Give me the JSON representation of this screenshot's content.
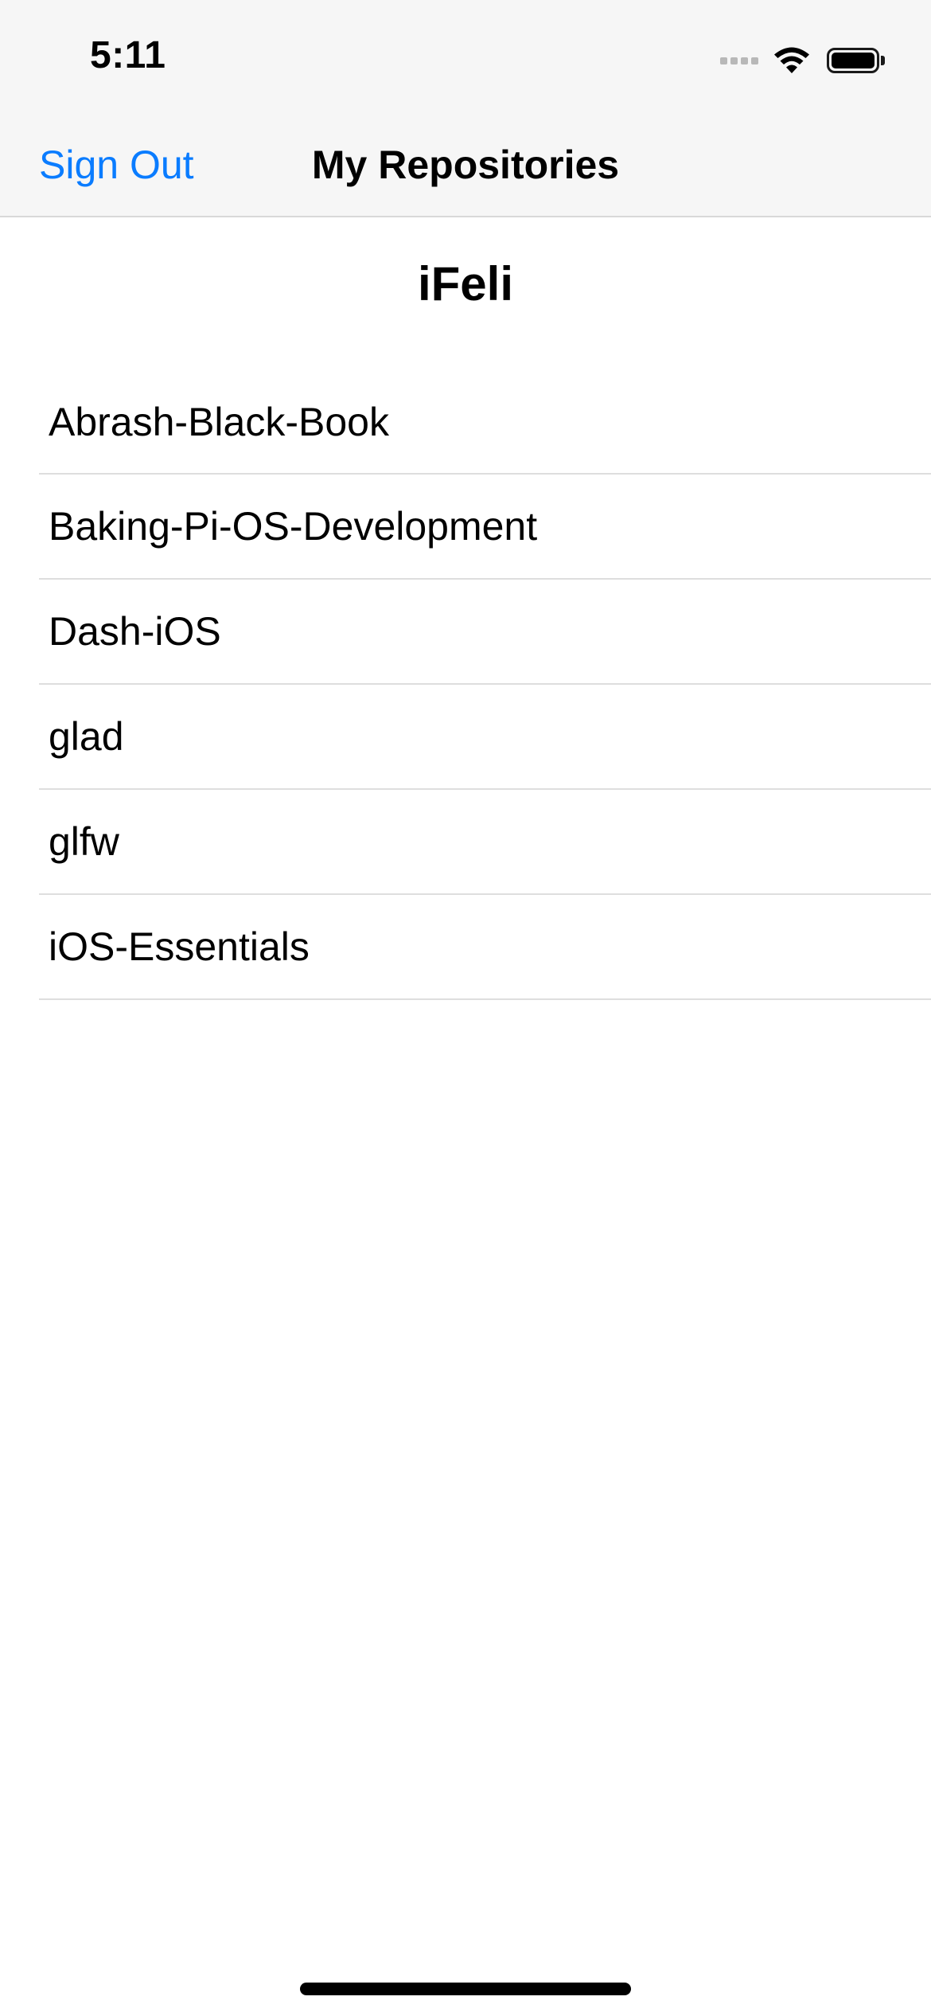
{
  "status_bar": {
    "time": "5:11",
    "icons": [
      "cellular-signal-icon",
      "wifi-icon",
      "battery-icon"
    ]
  },
  "nav": {
    "left_button": "Sign Out",
    "title": "My Repositories",
    "accent_color": "#0a7cff"
  },
  "section": {
    "header": "iFeli"
  },
  "repositories": [
    {
      "name": "Abrash-Black-Book"
    },
    {
      "name": "Baking-Pi-OS-Development"
    },
    {
      "name": "Dash-iOS"
    },
    {
      "name": "glad"
    },
    {
      "name": "glfw"
    },
    {
      "name": "iOS-Essentials"
    }
  ]
}
